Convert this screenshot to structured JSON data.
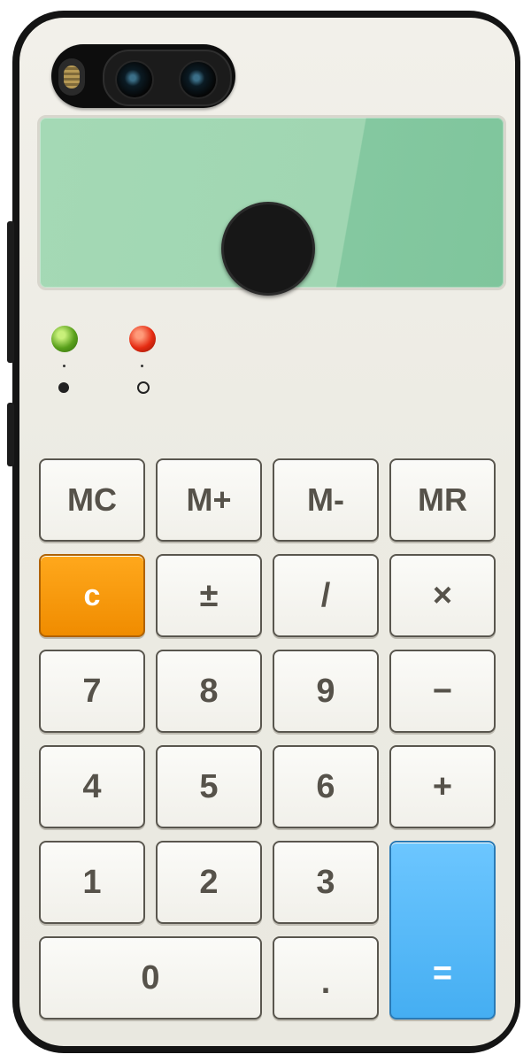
{
  "keys": {
    "mc": "MC",
    "m_plus": "M+",
    "m_minus": "M-",
    "mr": "MR",
    "clear": "c",
    "plus_minus": "±",
    "divide": "/",
    "multiply": "×",
    "seven": "7",
    "eight": "8",
    "nine": "9",
    "minus": "−",
    "four": "4",
    "five": "5",
    "six": "6",
    "plus": "+",
    "one": "1",
    "two": "2",
    "three": "3",
    "zero": "0",
    "decimal": ".",
    "equals": "="
  },
  "colors": {
    "display": "#a0d6b2",
    "clear_key": "#f29100",
    "equals_key": "#4fb5f5",
    "led_green": "#5aa01c",
    "led_red": "#e52b12"
  },
  "icons": {
    "camera": "dual-camera-icon",
    "fingerprint": "fingerprint-sensor-icon"
  }
}
